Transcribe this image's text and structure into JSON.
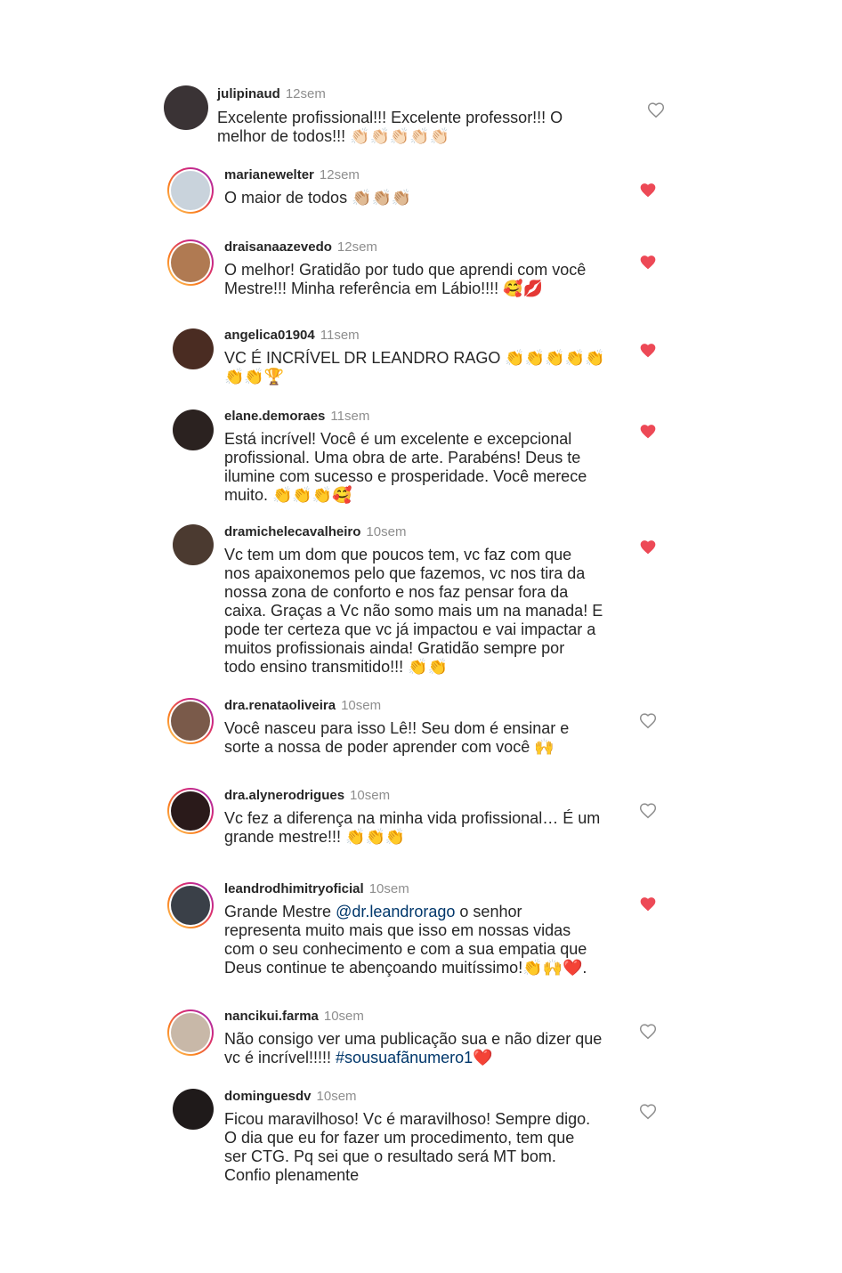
{
  "comments": [
    {
      "username": "julipinaud",
      "time": "12sem",
      "text": "Excelente profissional!!! Excelente professor!!! O\nmelhor de todos!!! 👏🏻👏🏻👏🏻👏🏻👏🏻",
      "liked": false,
      "avatar_color": "#3a3335",
      "story_ring": false
    },
    {
      "username": "marianewelter",
      "time": "12sem",
      "text": "O maior de todos 👏🏼👏🏼👏🏼",
      "liked": true,
      "avatar_color": "#c9d3dc",
      "story_ring": true
    },
    {
      "username": "draisanaazevedo",
      "time": "12sem",
      "text": "O melhor! Gratidão por tudo que aprendi com você\nMestre!!! Minha referência em Lábio!!!! 🥰💋",
      "liked": true,
      "avatar_color": "#b07a52",
      "story_ring": true
    },
    {
      "username": "angelica01904",
      "time": "11sem",
      "text": "VC É INCRÍVEL DR LEANDRO RAGO 👏👏👏👏👏\n👏👏🏆",
      "liked": true,
      "avatar_color": "#4a2c22",
      "story_ring": false
    },
    {
      "username": "elane.demoraes",
      "time": "11sem",
      "text": "Está incrível! Você é um excelente e excepcional\nprofissional. Uma obra de arte. Parabéns! Deus te\nilumine com sucesso e prosperidade.  Você merece\nmuito. 👏👏👏🥰",
      "liked": true,
      "avatar_color": "#2b2220",
      "story_ring": false
    },
    {
      "username": "dramichelecavalheiro",
      "time": "10sem",
      "text": "Vc tem um dom que poucos tem, vc faz com que\nnos apaixonemos pelo que fazemos, vc nos tira da\nnossa zona de conforto e nos faz pensar fora da\ncaixa. Graças a Vc não somo mais um na manada! E\npode ter certeza que vc já impactou e vai impactar a\nmuitos profissionais ainda! Gratidão sempre por\ntodo ensino transmitido!!! 👏👏",
      "liked": true,
      "avatar_color": "#4b3a30",
      "story_ring": false
    },
    {
      "username": "dra.renataoliveira",
      "time": "10sem",
      "text": "Você nasceu para isso Lê!! Seu dom é ensinar e\nsorte a nossa de poder aprender com você 🙌",
      "liked": false,
      "avatar_color": "#7a5a4a",
      "story_ring": true
    },
    {
      "username": "dra.alynerodrigues",
      "time": "10sem",
      "text": "Vc fez a diferença na minha vida profissional… É um\ngrande mestre!!! 👏👏👏",
      "liked": false,
      "avatar_color": "#2a1a1a",
      "story_ring": true
    },
    {
      "username": "leandrodhimitryoficial",
      "time": "10sem",
      "text_parts": [
        "Grande Mestre ",
        "@dr.leandrorago",
        " o senhor\nrepresenta muito mais que isso em nossas vidas\ncom o seu conhecimento  e com a sua empatia que\nDeus continue te abençoando muitíssimo!👏🙌❤️."
      ],
      "liked": true,
      "avatar_color": "#3a4048",
      "story_ring": true
    },
    {
      "username": "nancikui.farma",
      "time": "10sem",
      "text_parts": [
        "Não consigo ver uma publicação sua e não dizer que\nvc é incrível!!!!! ",
        "#sousuafãnumero1",
        "❤️"
      ],
      "liked": false,
      "avatar_color": "#c8b8a8",
      "story_ring": true
    },
    {
      "username": "dominguesdv",
      "time": "10sem",
      "text": "Ficou maravilhoso! Vc é maravilhoso! Sempre digo.\nO dia que eu for fazer um procedimento, tem que\nser CTG. Pq sei que o resultado será MT bom.\nConfio plenamente",
      "liked": false,
      "avatar_color": "#1f1a1a",
      "story_ring": false
    }
  ],
  "colors": {
    "like_active": "#ed4956",
    "like_inactive": "#8e8e8e",
    "link": "#00376b",
    "meta": "#8e8e8e"
  }
}
